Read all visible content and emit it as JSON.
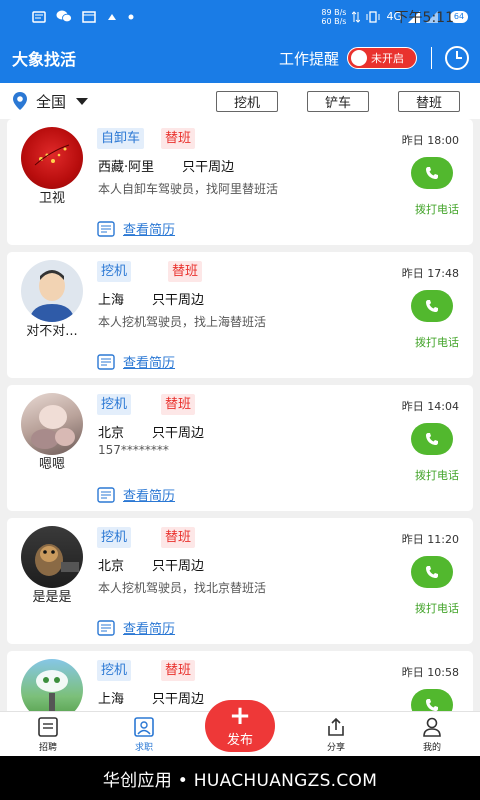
{
  "status_bar": {
    "time": "下午5:11",
    "net_up": "89 B/s",
    "net_down": "60 B/s",
    "network": "4G",
    "battery": "64"
  },
  "app_bar": {
    "title": "大象找活",
    "reminder_label": "工作提醒",
    "toggle_text": "未开启"
  },
  "filter": {
    "location": "全国",
    "tags": [
      "挖机",
      "铲车",
      "替班"
    ]
  },
  "resume_label": "查看简历",
  "call_label": "拨打电话",
  "cards": [
    {
      "name": "卫视",
      "type": "自卸车",
      "shift": "替班",
      "time": "昨日 18:00",
      "city": "西藏·阿里",
      "area": "只干周边",
      "desc": "本人自卸车驾驶员，找阿里替班活"
    },
    {
      "name": "对不对...",
      "type": "挖机",
      "shift": "替班",
      "time": "昨日 17:48",
      "city": "上海",
      "area": "只干周边",
      "desc": "本人挖机驾驶员，找上海替班活"
    },
    {
      "name": "嗯嗯",
      "type": "挖机",
      "shift": "替班",
      "time": "昨日 14:04",
      "city": "北京",
      "area": "只干周边",
      "desc": "157********"
    },
    {
      "name": "是是是",
      "type": "挖机",
      "shift": "替班",
      "time": "昨日 11:20",
      "city": "北京",
      "area": "只干周边",
      "desc": "本人挖机驾驶员，找北京替班活"
    },
    {
      "name": "",
      "type": "挖机",
      "shift": "替班",
      "time": "昨日 10:58",
      "city": "上海",
      "area": "只干周边",
      "desc": ""
    }
  ],
  "bottom_nav": {
    "items": [
      "招聘",
      "求职",
      "分享",
      "我的"
    ],
    "publish": "发布"
  },
  "watermark": "华创应用 • HUACHUANGZS.COM"
}
